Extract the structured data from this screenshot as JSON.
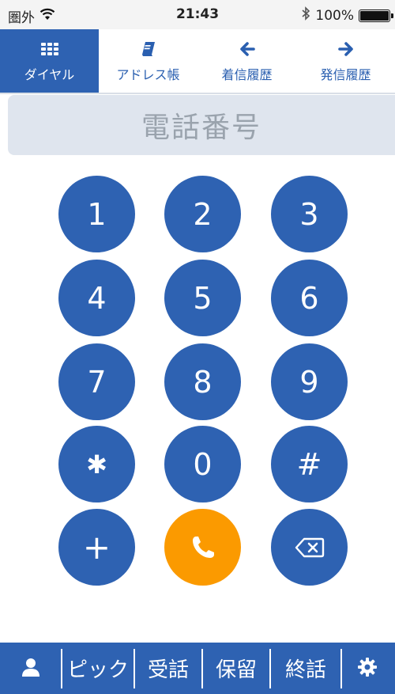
{
  "status_bar": {
    "carrier": "圏外",
    "time": "21:43",
    "battery_percent": "100%",
    "battery_level": 1.0,
    "icons": [
      "wifi-icon",
      "bluetooth-icon",
      "battery-icon"
    ]
  },
  "tabs": [
    {
      "label": "ダイヤル",
      "icon": "keypad-grid-icon",
      "active": true
    },
    {
      "label": "アドレス帳",
      "icon": "book-icon",
      "active": false
    },
    {
      "label": "着信履歴",
      "icon": "arrow-left-icon",
      "active": false
    },
    {
      "label": "発信履歴",
      "icon": "arrow-right-icon",
      "active": false
    }
  ],
  "number_field": {
    "placeholder": "電話番号"
  },
  "keypad": {
    "keys": [
      "1",
      "2",
      "3",
      "4",
      "5",
      "6",
      "7",
      "8",
      "9",
      "✱",
      "0",
      "#",
      "+"
    ],
    "call_icon": "phone-icon",
    "delete_icon": "backspace-icon"
  },
  "bottom_bar": {
    "pick": "ピック",
    "answer": "受話",
    "hold": "保留",
    "end": "終話",
    "icons": [
      "user-icon",
      "gear-icon"
    ]
  },
  "colors": {
    "primary_blue": "#2e62b2",
    "call_orange": "#fb9a00",
    "display_background": "#dfe5ee",
    "placeholder_gray": "#9aa3ad"
  }
}
